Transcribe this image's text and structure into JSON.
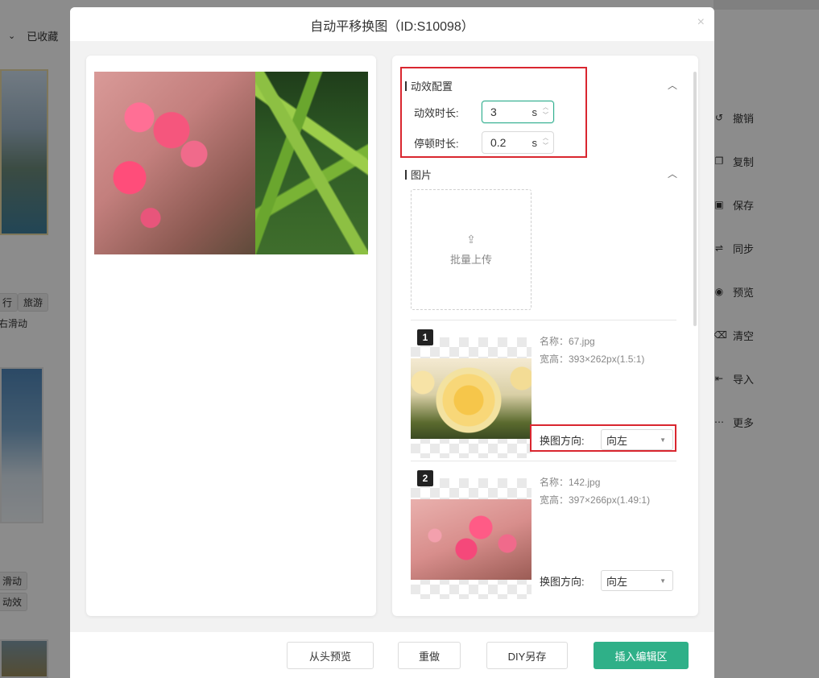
{
  "background": {
    "favorited_label": "已收藏",
    "tags": [
      "行",
      "旅游",
      "右滑动",
      "滑动",
      "动效"
    ],
    "right_actions": [
      {
        "icon": "undo-icon",
        "label": "撤销"
      },
      {
        "icon": "copy-icon",
        "label": "复制"
      },
      {
        "icon": "save-icon",
        "label": "保存"
      },
      {
        "icon": "sync-icon",
        "label": "同步"
      },
      {
        "icon": "eye-icon",
        "label": "预览"
      },
      {
        "icon": "clear-icon",
        "label": "清空"
      },
      {
        "icon": "import-icon",
        "label": "导入"
      },
      {
        "icon": "more-icon",
        "label": "更多"
      }
    ]
  },
  "dialog": {
    "title": "自动平移换图（ID:S10098）",
    "close_glyph": "×"
  },
  "config": {
    "animation_section_title": "动效配置",
    "duration_label": "动效时长:",
    "duration_value": "3",
    "duration_unit": "s",
    "pause_label": "停顿时长:",
    "pause_value": "0.2",
    "pause_unit": "s",
    "images_section_title": "图片",
    "upload_label": "批量上传",
    "images": [
      {
        "index": "1",
        "name_text": "名称：67.jpg",
        "size_text": "宽高：393×262px(1.5:1)",
        "direction_label": "换图方向:",
        "direction_value": "向左"
      },
      {
        "index": "2",
        "name_text": "名称：142.jpg",
        "size_text": "宽高：397×266px(1.49:1)",
        "direction_label": "换图方向:",
        "direction_value": "向左"
      }
    ]
  },
  "footer": {
    "replay_label": "从头预览",
    "redo_label": "重做",
    "diy_save_label": "DIY另存",
    "insert_label": "插入编辑区"
  },
  "colors": {
    "accent": "#2fb088",
    "highlight": "#d9262f"
  }
}
